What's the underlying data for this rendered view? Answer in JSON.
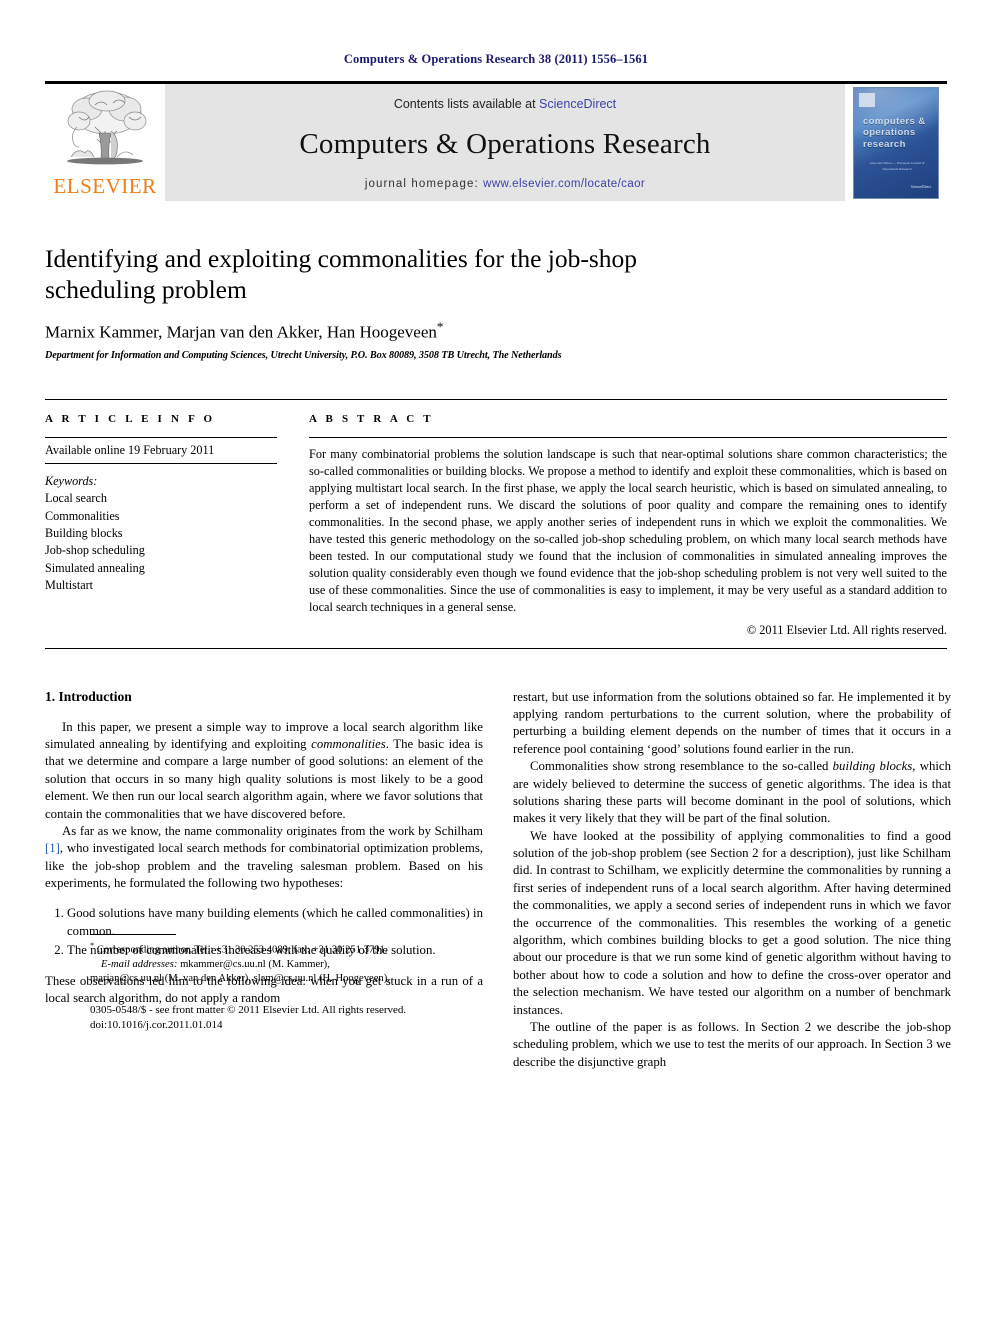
{
  "running_head": "Computers & Operations Research 38 (2011) 1556–1561",
  "masthead": {
    "publisher_logo_text": "ELSEVIER",
    "contents_prefix": "Contents lists available at ",
    "contents_link": "ScienceDirect",
    "journal_name": "Computers & Operations Research",
    "homepage_prefix": "journal homepage: ",
    "homepage_url": "www.elsevier.com/locate/caor",
    "cover": {
      "title": "computers & operations research",
      "subtitle_lines": "Associate Editor — European Journal of Operational Research",
      "sciencedirect_label": "ScienceDirect"
    },
    "colors": {
      "band_background": "#e4e4e4",
      "link_blue": "#3a41a8",
      "elsevier_orange": "#ef7d1a",
      "running_head_navy": "#1a1a6e",
      "cover_blue": "#2f5ea8"
    }
  },
  "title_block": {
    "title": "Identifying and exploiting commonalities for the job-shop scheduling problem",
    "authors": "Marnix Kammer, Marjan van den Akker, Han Hoogeveen",
    "author_marker": "*",
    "affiliation": "Department for Information and Computing Sciences, Utrecht University, P.O. Box 80089, 3508 TB Utrecht, The Netherlands"
  },
  "article_info": {
    "heading": "A R T I C L E   I N F O",
    "available_online": "Available online 19 February 2011",
    "keywords_label": "Keywords:",
    "keywords": [
      "Local search",
      "Commonalities",
      "Building blocks",
      "Job-shop scheduling",
      "Simulated annealing",
      "Multistart"
    ]
  },
  "abstract": {
    "heading": "A B S T R A C T",
    "text": "For many combinatorial problems the solution landscape is such that near-optimal solutions share common characteristics; the so-called commonalities or building blocks. We propose a method to identify and exploit these commonalities, which is based on applying multistart local search. In the first phase, we apply the local search heuristic, which is based on simulated annealing, to perform a set of independent runs. We discard the solutions of poor quality and compare the remaining ones to identify commonalities. In the second phase, we apply another series of independent runs in which we exploit the commonalities. We have tested this generic methodology on the so-called job-shop scheduling problem, on which many local search methods have been tested. In our computational study we found that the inclusion of commonalities in simulated annealing improves the solution quality considerably even though we found evidence that the job-shop scheduling problem is not very well suited to the use of these commonalities. Since the use of commonalities is easy to implement, it may be very useful as a standard addition to local search techniques in a general sense.",
    "copyright": "© 2011 Elsevier Ltd. All rights reserved."
  },
  "body": {
    "section_title": "1.  Introduction",
    "left_p1_a": "In this paper, we present a simple way to improve a local search algorithm like simulated annealing by identifying and exploiting ",
    "left_p1_italic": "commonalities",
    "left_p1_b": ". The basic idea is that we determine and compare a large number of good solutions: an element of the solution that occurs in so many high quality solutions is most likely to be a good element. We then run our local search algorithm again, where we favor solutions that contain the commonalities that we have discovered before.",
    "left_p2_a": "As far as we know, the name commonality originates from the work by Schilham ",
    "left_p2_cite": "[1]",
    "left_p2_b": ", who investigated local search methods for combinatorial optimization problems, like the job-shop problem and the traveling salesman problem. Based on his experiments, he formulated the following two hypotheses:",
    "hypotheses": [
      "Good solutions have many building elements (which he called commonalities) in common.",
      "The number of commonalities increases with the quality of the solution."
    ],
    "left_p3": "These observations led him to the following idea: when you get stuck in a run of a local search algorithm, do not apply a random",
    "right_p1": "restart, but use information from the solutions obtained so far. He implemented it by applying random perturbations to the current solution, where the probability of perturbing a building element depends on the number of times that it occurs in a reference pool containing ‘good’ solutions found earlier in the run.",
    "right_p2_a": "Commonalities show strong resemblance to the so-called ",
    "right_p2_italic": "building blocks",
    "right_p2_b": ", which are widely believed to determine the success of genetic algorithms. The idea is that solutions sharing these parts will become dominant in the pool of solutions, which makes it very likely that they will be part of the final solution.",
    "right_p3": "We have looked at the possibility of applying commonalities to find a good solution of the job-shop problem (see Section 2 for a description), just like Schilham did. In contrast to Schilham, we explicitly determine the commonalities by running a first series of independent runs of a local search algorithm. After having determined the commonalities, we apply a second series of independent runs in which we favor the occurrence of the commonalities. This resembles the working of a genetic algorithm, which combines building blocks to get a good solution. The nice thing about our procedure is that we run some kind of genetic algorithm without having to bother about how to code a solution and how to define the cross-over operator and the selection mechanism. We have tested our algorithm on a number of benchmark instances.",
    "right_p4": "The outline of the paper is as follows. In Section 2 we describe the job-shop scheduling problem, which we use to test the merits of our approach. In Section 3 we describe the disjunctive graph"
  },
  "footnotes": {
    "corresponding": "Corresponding author. Tel.: +31 30 253 4089; fax: +31 30 251 3791.",
    "emails_label": "E-mail addresses:",
    "emails_line1": "mkammer@cs.uu.nl (M. Kammer),",
    "emails_line2": "marjan@cs.uu.nl (M. van den Akker), slam@cs.uu.nl (H. Hoogeveen).",
    "issn_line": "0305-0548/$ - see front matter © 2011 Elsevier Ltd. All rights reserved.",
    "doi_line": "doi:10.1016/j.cor.2011.01.014"
  }
}
